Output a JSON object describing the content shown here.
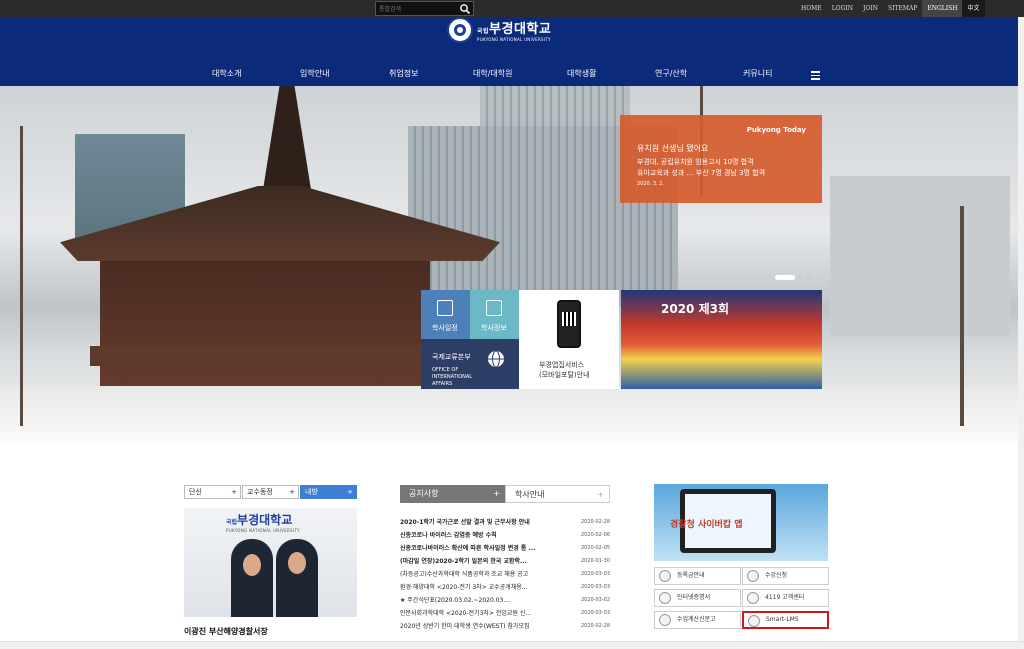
{
  "topbar": {
    "search_placeholder": "통합검색",
    "links": [
      "HOME",
      "LOGIN",
      "JOIN",
      "SITEMAP",
      "ENGLISH",
      "中文"
    ]
  },
  "header": {
    "logo_prefix": "국립",
    "logo_main": "부경대학교",
    "logo_sub": "PUKYONG NATIONAL UNIVERSITY",
    "nav": [
      "대학소개",
      "입학안내",
      "취업정보",
      "대학/대학원",
      "대학생활",
      "연구/산학",
      "커뮤니티"
    ]
  },
  "today": {
    "tag": "Pukyong Today",
    "headline": "유치원 선생님 됐어요",
    "line1": "부경대, 공립유치원 임용고시 10명 합격",
    "line2": "유아교육과 성과 … 부산 7명 경남 3명 합격",
    "date": "2020. 3. 2."
  },
  "tiles": {
    "schedule": "학사일정",
    "academic": "학사정보",
    "intl_kr": "국제교류본부",
    "intl_en": "OFFICE OF INTERNATIONAL AFFAIRS",
    "mobile_1": "부경앱집서비스",
    "mobile_2": "(모바일포탈)안내",
    "banner_text": "2020 제3회"
  },
  "left_tabs": [
    "단신",
    "교수동정",
    "내방"
  ],
  "left_photo": {
    "logo_prefix": "국립",
    "logo_main": "부경대학교",
    "logo_sub": "PUKYONG NATIONAL UNIVERSITY",
    "caption": "이광진 부산해양경찰서장"
  },
  "notice_tabs": [
    "공지사항",
    "학사안내"
  ],
  "notices": [
    {
      "title": "2020-1학기 국가근로 선발 결과 및 근무사항 안내",
      "date": "2020-02-28",
      "bold": true
    },
    {
      "title": "신종코로나 바이러스 감염증 예방 수칙",
      "date": "2020-02-06",
      "bold": true
    },
    {
      "title": "신종코로나바이러스 확산에 따른 학사일정 변경 통 ...",
      "date": "2020-02-05",
      "bold": true
    },
    {
      "title": "(마감일 연장)2020-2학기 일본의 한국 교환학...",
      "date": "2020-01-30",
      "bold": true
    },
    {
      "title": "(차등공고)수산과학대학 식품공학과 조교 채용 공고",
      "date": "2020-03-03",
      "bold": false
    },
    {
      "title": "환경·해양대학 <2020-전기 3차> 교수공개채용...",
      "date": "2020-03-03",
      "bold": false
    },
    {
      "title": "★ 주간식단표(2020.03.02.~2020.03....",
      "date": "2020-03-02",
      "bold": false
    },
    {
      "title": "인문사회과학대학 <2020-전기3차> 전임교원 신...",
      "date": "2020-03-03",
      "bold": false
    },
    {
      "title": "2020년 상반기 한미 대학생 연수(WEST) 참가모집",
      "date": "2020-02-28",
      "bold": false
    }
  ],
  "right_banner": "경찰청 사이버캅 앱",
  "quick_links": [
    "등록금안내",
    "수강신청",
    "인터넷증명서",
    "4119 고객센터",
    "수업계산신문고",
    "Smart-LMS"
  ]
}
